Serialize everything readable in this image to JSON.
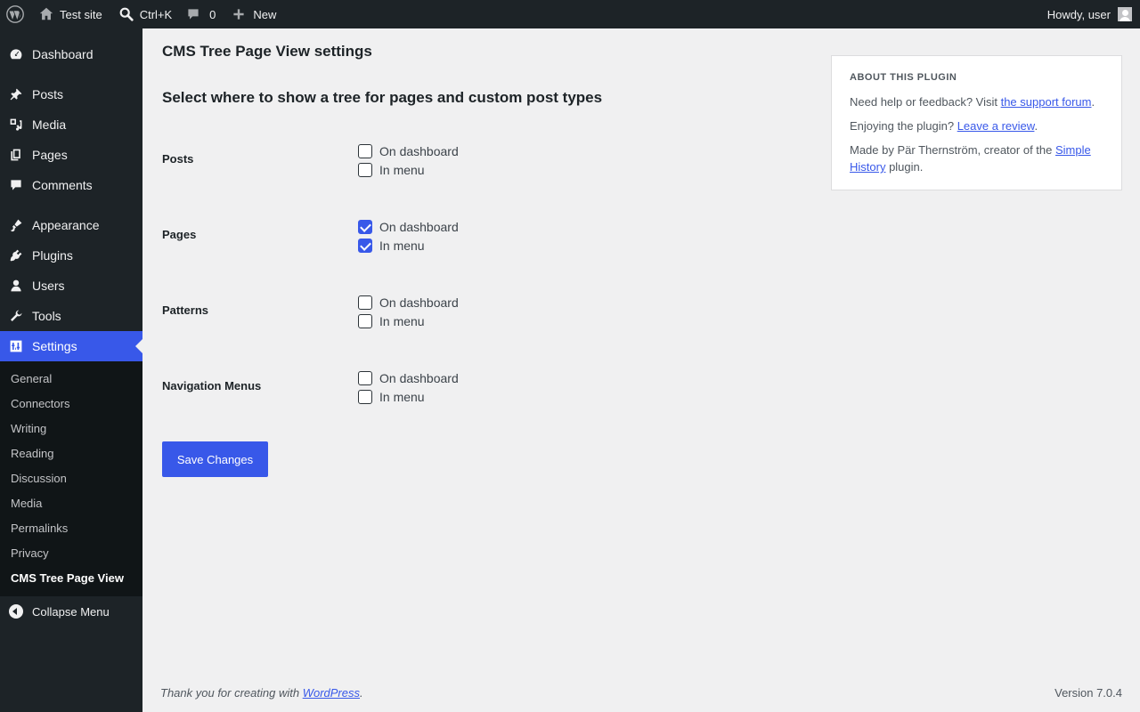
{
  "adminbar": {
    "site_name": "Test site",
    "search_shortcut": "Ctrl+K",
    "comments_count": "0",
    "new_label": "New",
    "howdy": "Howdy, user"
  },
  "sidebar": {
    "items": [
      {
        "label": "Dashboard",
        "icon": "dashboard-icon"
      },
      {
        "label": "Posts",
        "icon": "pin-icon"
      },
      {
        "label": "Media",
        "icon": "media-icon"
      },
      {
        "label": "Pages",
        "icon": "pages-icon"
      },
      {
        "label": "Comments",
        "icon": "comment-icon"
      },
      {
        "label": "Appearance",
        "icon": "brush-icon"
      },
      {
        "label": "Plugins",
        "icon": "plugin-icon"
      },
      {
        "label": "Users",
        "icon": "user-icon"
      },
      {
        "label": "Tools",
        "icon": "wrench-icon"
      },
      {
        "label": "Settings",
        "icon": "settings-icon"
      }
    ],
    "submenu": [
      "General",
      "Connectors",
      "Writing",
      "Reading",
      "Discussion",
      "Media",
      "Permalinks",
      "Privacy",
      "CMS Tree Page View"
    ],
    "collapse_label": "Collapse Menu"
  },
  "main": {
    "title": "CMS Tree Page View settings",
    "section_title": "Select where to show a tree for pages and custom post types",
    "rows": [
      {
        "label": "Posts",
        "dashboard": false,
        "menu": false
      },
      {
        "label": "Pages",
        "dashboard": true,
        "menu": true
      },
      {
        "label": "Patterns",
        "dashboard": false,
        "menu": false
      },
      {
        "label": "Navigation Menus",
        "dashboard": false,
        "menu": false
      }
    ],
    "option_dashboard": "On dashboard",
    "option_menu": "In menu",
    "save_label": "Save Changes"
  },
  "about": {
    "heading": "ABOUT THIS PLUGIN",
    "help_prefix": "Need help or feedback? Visit ",
    "help_link": "the support forum",
    "help_suffix": ".",
    "enjoy_prefix": "Enjoying the plugin? ",
    "enjoy_link": "Leave a review",
    "enjoy_suffix": ".",
    "made_prefix": "Made by Pär Thernström, creator of the ",
    "made_link": "Simple History",
    "made_suffix": " plugin."
  },
  "footer": {
    "thanks_prefix": "Thank you for creating with ",
    "thanks_link": "WordPress",
    "thanks_suffix": ".",
    "version": "Version 7.0.4"
  },
  "colors": {
    "accent": "#3858e9",
    "adminbar_bg": "#1d2327",
    "content_bg": "#f0f0f1"
  }
}
